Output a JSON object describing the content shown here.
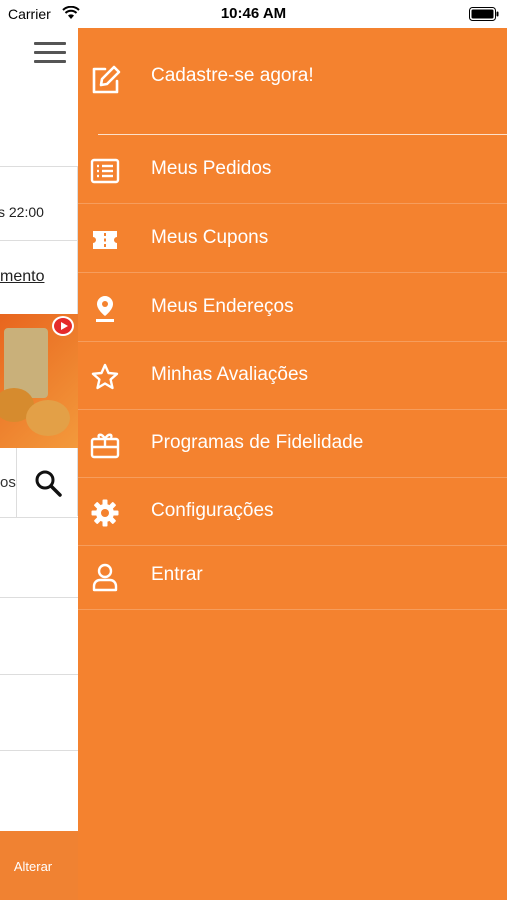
{
  "status_bar": {
    "carrier": "Carrier",
    "time": "10:46 AM"
  },
  "background_page": {
    "hours_text": "s 22:00",
    "hours_link": "mento",
    "search_text": "os",
    "alterar_label": "Alterar"
  },
  "drawer": {
    "header": {
      "label": "Cadastre-se agora!",
      "icon": "edit-icon"
    },
    "items": [
      {
        "label": "Meus Pedidos",
        "icon": "list-icon"
      },
      {
        "label": "Meus Cupons",
        "icon": "ticket-icon"
      },
      {
        "label": "Meus Endereços",
        "icon": "location-pin-icon"
      },
      {
        "label": "Minhas Avaliações",
        "icon": "star-icon"
      },
      {
        "label": "Programas de Fidelidade",
        "icon": "gift-card-icon"
      },
      {
        "label": "Configurações",
        "icon": "gear-icon"
      },
      {
        "label": "Entrar",
        "icon": "user-icon"
      }
    ]
  },
  "colors": {
    "drawer_background": "#f4822f",
    "accent": "#f08232",
    "text_on_accent": "#ffffff"
  }
}
